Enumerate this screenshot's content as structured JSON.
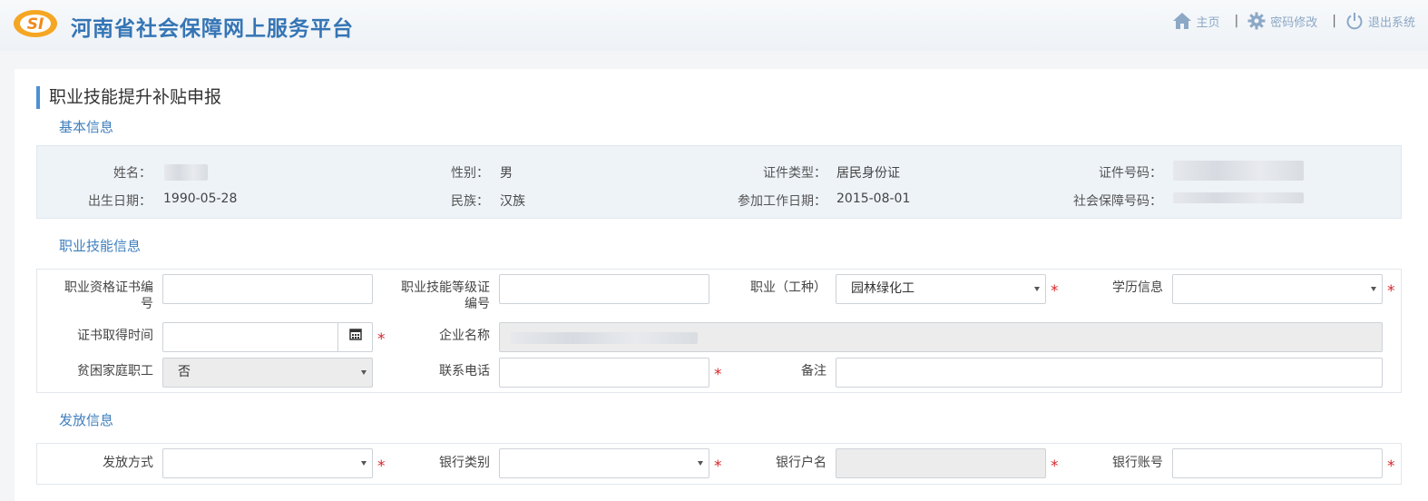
{
  "header": {
    "site_title": "河南省社会保障网上服务平台",
    "logo_text": "SI",
    "nav": [
      {
        "label": "主页",
        "icon": "home-icon"
      },
      {
        "label": "密码修改",
        "icon": "gear-icon"
      },
      {
        "label": "退出系统",
        "icon": "power-icon"
      }
    ],
    "separator": "|"
  },
  "page": {
    "title": "职业技能提升补贴申报"
  },
  "basic_info": {
    "section_title": "基本信息",
    "name_label": "姓名：",
    "name_value": "",
    "gender_label": "性别：",
    "gender_value": "男",
    "id_type_label": "证件类型：",
    "id_type_value": "居民身份证",
    "id_number_label": "证件号码：",
    "id_number_value": "",
    "birth_label": "出生日期：",
    "birth_value": "1990-05-28",
    "ethnic_label": "民族：",
    "ethnic_value": "汉族",
    "work_date_label": "参加工作日期：",
    "work_date_value": "2015-08-01",
    "ssn_label": "社会保障号码：",
    "ssn_value": ""
  },
  "skill_info": {
    "section_title": "职业技能信息",
    "cert_no_label": "职业资格证书编号",
    "cert_no_value": "",
    "level_no_label": "职业技能等级证编号",
    "level_no_value": "",
    "occupation_label": "职业（工种）",
    "occupation_value": "园林绿化工",
    "education_label": "学历信息",
    "education_value": "",
    "cert_date_label": "证书取得时间",
    "cert_date_value": "",
    "company_label": "企业名称",
    "company_value": "",
    "poor_family_label": "贫困家庭职工",
    "poor_family_value": "否",
    "phone_label": "联系电话",
    "phone_value": "",
    "remark_label": "备注",
    "remark_value": ""
  },
  "payment_info": {
    "section_title": "发放信息",
    "method_label": "发放方式",
    "method_value": "",
    "bank_type_label": "银行类别",
    "bank_type_value": "",
    "account_name_label": "银行户名",
    "account_name_value": "",
    "account_no_label": "银行账号",
    "account_no_value": ""
  },
  "required_mark": "*",
  "colors": {
    "brand_blue": "#3575b5",
    "section_blue": "#3f7fbe",
    "required_red": "#d9262c",
    "logo_orange": "#f5a623"
  }
}
